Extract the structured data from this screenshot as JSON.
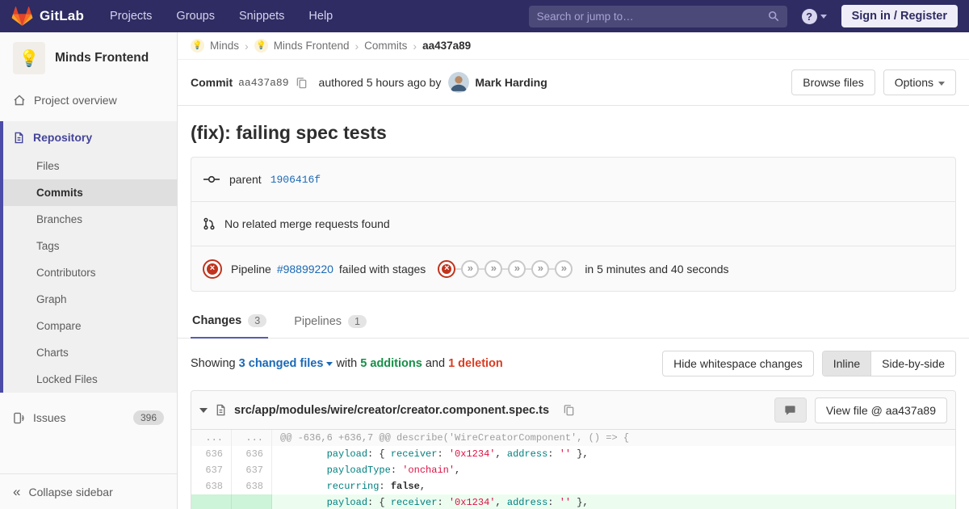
{
  "navbar": {
    "brand": "GitLab",
    "links": [
      "Projects",
      "Groups",
      "Snippets",
      "Help"
    ],
    "search_placeholder": "Search or jump to…",
    "help_glyph": "?",
    "signin": "Sign in / Register"
  },
  "sidebar": {
    "project_name": "Minds Frontend",
    "project_avatar": "💡",
    "overview": "Project overview",
    "repository": "Repository",
    "repo_items": [
      "Files",
      "Commits",
      "Branches",
      "Tags",
      "Contributors",
      "Graph",
      "Compare",
      "Charts",
      "Locked Files"
    ],
    "active_repo_item": "Commits",
    "issues": "Issues",
    "issues_count": "396",
    "collapse": "Collapse sidebar",
    "collapse_glyph": "«"
  },
  "breadcrumb": {
    "group": "Minds",
    "project": "Minds Frontend",
    "section": "Commits",
    "current": "aa437a89",
    "sep": "›"
  },
  "commit": {
    "label": "Commit",
    "sha": "aa437a89",
    "authored": "authored 5 hours ago by",
    "author": "Mark Harding",
    "browse_files": "Browse files",
    "options": "Options",
    "title": "(fix): failing spec tests",
    "parent_label": "parent",
    "parent_sha": "1906416f",
    "mr_text": "No related merge requests found",
    "pipeline_label": "Pipeline",
    "pipeline_id": "#98899220",
    "pipeline_status": "failed with stages",
    "pipeline_duration": "in 5 minutes and 40 seconds",
    "stages": [
      "failed",
      "skipped",
      "skipped",
      "skipped",
      "skipped",
      "skipped"
    ]
  },
  "tabs": {
    "changes": "Changes",
    "changes_count": "3",
    "pipelines": "Pipelines",
    "pipelines_count": "1"
  },
  "summary": {
    "showing": "Showing",
    "files": "3 changed files",
    "with": "with",
    "additions": "5 additions",
    "and": "and",
    "deletions": "1 deletion",
    "hide_whitespace": "Hide whitespace changes",
    "inline": "Inline",
    "side_by_side": "Side-by-side"
  },
  "diff": {
    "file_path": "src/app/modules/wire/creator/creator.component.spec.ts",
    "view_file": "View file @ aa437a89",
    "rows": [
      {
        "old": "...",
        "new": "...",
        "type": "hunk",
        "tokens": [
          {
            "t": "@@ -636,6 +636,7 @@ describe('WireCreatorComponent', () => {",
            "c": "tok-hunk"
          }
        ]
      },
      {
        "old": "636",
        "new": "636",
        "type": "ctx",
        "tokens": [
          {
            "t": "        ",
            "c": ""
          },
          {
            "t": "payload",
            "c": "tok-na"
          },
          {
            "t": ": { ",
            "c": ""
          },
          {
            "t": "receiver",
            "c": "tok-na"
          },
          {
            "t": ": ",
            "c": ""
          },
          {
            "t": "'0x1234'",
            "c": "tok-s"
          },
          {
            "t": ", ",
            "c": ""
          },
          {
            "t": "address",
            "c": "tok-na"
          },
          {
            "t": ": ",
            "c": ""
          },
          {
            "t": "''",
            "c": "tok-s"
          },
          {
            "t": " },",
            "c": ""
          }
        ]
      },
      {
        "old": "637",
        "new": "637",
        "type": "ctx",
        "tokens": [
          {
            "t": "        ",
            "c": ""
          },
          {
            "t": "payloadType",
            "c": "tok-na"
          },
          {
            "t": ": ",
            "c": ""
          },
          {
            "t": "'onchain'",
            "c": "tok-s"
          },
          {
            "t": ",",
            "c": ""
          }
        ]
      },
      {
        "old": "638",
        "new": "638",
        "type": "ctx",
        "tokens": [
          {
            "t": "        ",
            "c": ""
          },
          {
            "t": "recurring",
            "c": "tok-na"
          },
          {
            "t": ": ",
            "c": ""
          },
          {
            "t": "false",
            "c": "tok-kc"
          },
          {
            "t": ",",
            "c": ""
          }
        ]
      },
      {
        "old": "",
        "new": "",
        "type": "add",
        "tokens": [
          {
            "t": "        ",
            "c": ""
          },
          {
            "t": "payload",
            "c": "tok-na"
          },
          {
            "t": ": { ",
            "c": ""
          },
          {
            "t": "receiver",
            "c": "tok-na"
          },
          {
            "t": ": ",
            "c": ""
          },
          {
            "t": "'0x1234'",
            "c": "tok-s"
          },
          {
            "t": ", ",
            "c": ""
          },
          {
            "t": "address",
            "c": "tok-na"
          },
          {
            "t": ": ",
            "c": ""
          },
          {
            "t": "''",
            "c": "tok-s"
          },
          {
            "t": " },",
            "c": ""
          }
        ]
      }
    ]
  },
  "colors": {
    "navbar": "#2e2c62",
    "accent": "#4b4ba8",
    "link": "#1b69b6",
    "failed": "#c0341d",
    "added": "#168f48",
    "removed": "#db3b21"
  }
}
